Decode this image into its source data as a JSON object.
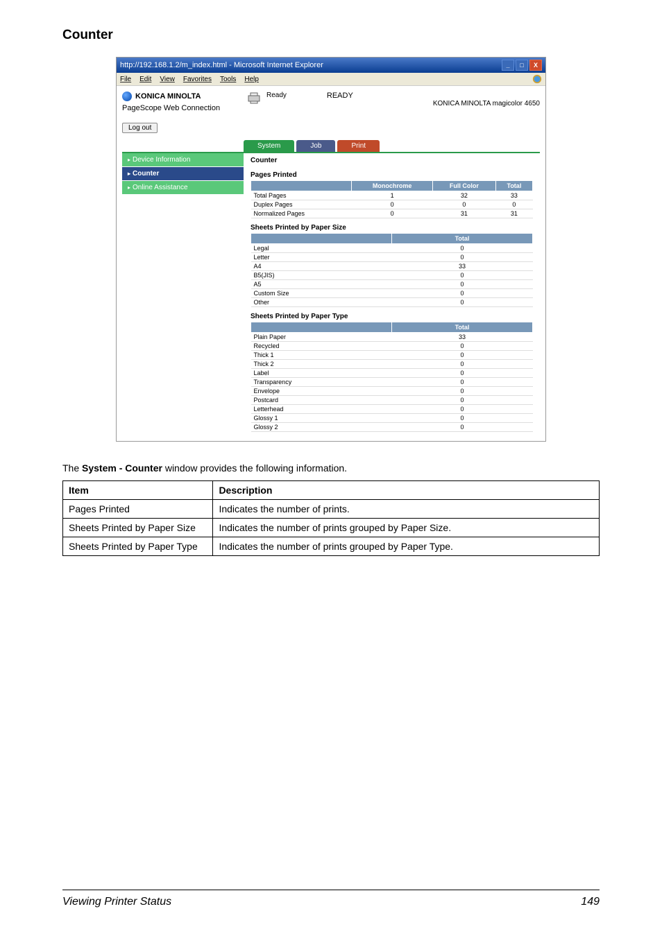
{
  "page": {
    "section_title": "Counter",
    "description": "The System - Counter window provides the following information.",
    "footer_left": "Viewing Printer Status",
    "footer_right": "149"
  },
  "window": {
    "title": "http://192.168.1.2/m_index.html - Microsoft Internet Explorer",
    "menu": [
      "File",
      "Edit",
      "View",
      "Favorites",
      "Tools",
      "Help"
    ]
  },
  "header": {
    "logo_text": "KONICA MINOLTA",
    "pagescope": "PageScope Web Connection",
    "status_label": "Ready",
    "status_text": "READY",
    "model": "KONICA MINOLTA magicolor 4650",
    "logout": "Log out"
  },
  "tabs": [
    {
      "label": "System",
      "active": true
    },
    {
      "label": "Job",
      "active": false
    },
    {
      "label": "Print",
      "active": false
    }
  ],
  "sidebar": [
    {
      "label": "Device Information",
      "selected": false
    },
    {
      "label": "Counter",
      "selected": true
    },
    {
      "label": "Online Assistance",
      "selected": false
    }
  ],
  "panel": {
    "title": "Counter",
    "pages_printed": {
      "title": "Pages Printed",
      "headers": [
        "",
        "Monochrome",
        "Full Color",
        "Total"
      ],
      "rows": [
        [
          "Total Pages",
          "1",
          "32",
          "33"
        ],
        [
          "Duplex Pages",
          "0",
          "0",
          "0"
        ],
        [
          "Normalized Pages",
          "0",
          "31",
          "31"
        ]
      ]
    },
    "sheets_by_size": {
      "title": "Sheets Printed by Paper Size",
      "headers": [
        "",
        "Total"
      ],
      "rows": [
        [
          "Legal",
          "0"
        ],
        [
          "Letter",
          "0"
        ],
        [
          "A4",
          "33"
        ],
        [
          "B5(JIS)",
          "0"
        ],
        [
          "A5",
          "0"
        ],
        [
          "Custom Size",
          "0"
        ],
        [
          "Other",
          "0"
        ]
      ]
    },
    "sheets_by_type": {
      "title": "Sheets Printed by Paper Type",
      "headers": [
        "",
        "Total"
      ],
      "rows": [
        [
          "Plain Paper",
          "33"
        ],
        [
          "Recycled",
          "0"
        ],
        [
          "Thick 1",
          "0"
        ],
        [
          "Thick 2",
          "0"
        ],
        [
          "Label",
          "0"
        ],
        [
          "Transparency",
          "0"
        ],
        [
          "Envelope",
          "0"
        ],
        [
          "Postcard",
          "0"
        ],
        [
          "Letterhead",
          "0"
        ],
        [
          "Glossy 1",
          "0"
        ],
        [
          "Glossy 2",
          "0"
        ]
      ]
    }
  },
  "info_table": {
    "headers": [
      "Item",
      "Description"
    ],
    "rows": [
      [
        "Pages Printed",
        "Indicates the number of prints."
      ],
      [
        "Sheets Printed by Paper Size",
        "Indicates the number of prints grouped by Paper Size."
      ],
      [
        "Sheets Printed by Paper Type",
        "Indicates the number of prints grouped by Paper Type."
      ]
    ]
  }
}
